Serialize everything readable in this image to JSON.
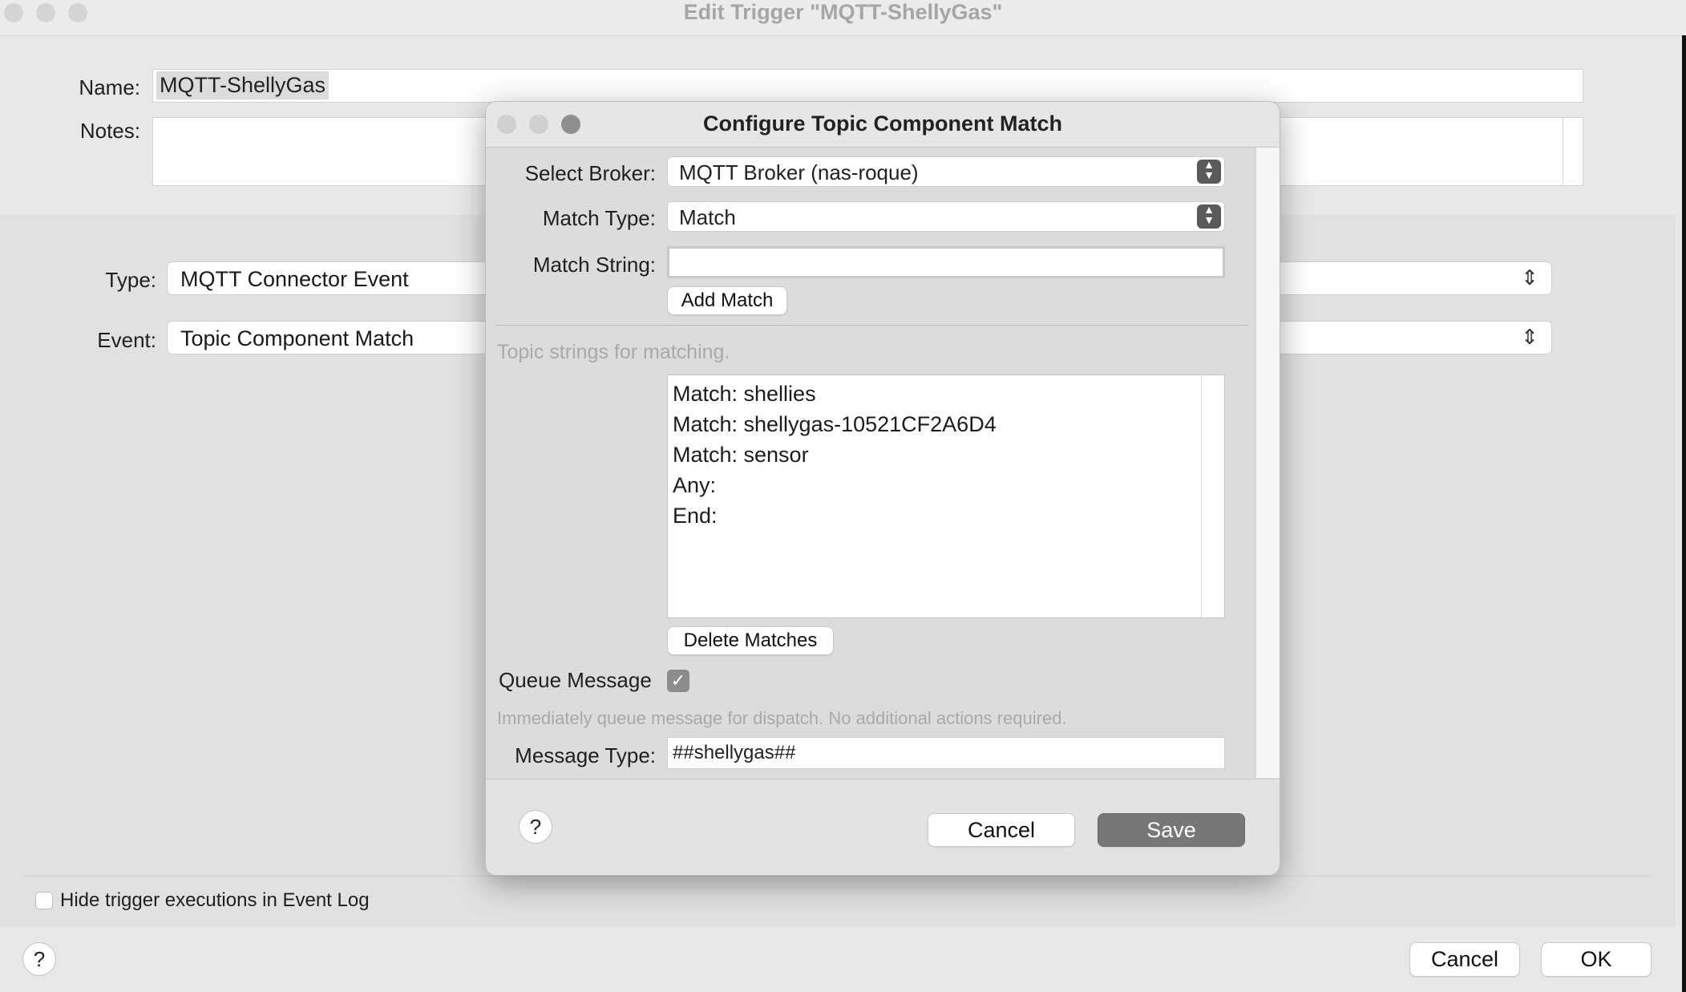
{
  "window": {
    "title": "Edit Trigger \"MQTT-ShellyGas\""
  },
  "form": {
    "name_label": "Name:",
    "name_value": "MQTT-ShellyGas",
    "notes_label": "Notes:",
    "type_label": "Type:",
    "type_value": "MQTT Connector Event",
    "event_label": "Event:",
    "event_value": "Topic Component Match",
    "hide_label": "Hide trigger executions in Event Log"
  },
  "bottom_buttons": {
    "help": "?",
    "cancel": "Cancel",
    "ok": "OK"
  },
  "modal": {
    "title": "Configure Topic Component Match",
    "broker_label": "Select Broker:",
    "broker_value": "MQTT Broker (nas-roque)",
    "match_type_label": "Match Type:",
    "match_type_value": "Match",
    "match_string_label": "Match String:",
    "match_string_value": "",
    "add_match": "Add Match",
    "topic_strings_hint": "Topic strings for matching.",
    "matches": [
      "Match: shellies",
      "Match: shellygas-10521CF2A6D4",
      "Match: sensor",
      "Any:",
      "End:"
    ],
    "delete_matches": "Delete Matches",
    "queue_label": "Queue Message",
    "queue_checked": true,
    "queue_hint": "Immediately queue message for dispatch.  No additional actions required.",
    "message_type_label": "Message Type:",
    "message_type_value": "##shellygas##",
    "help": "?",
    "cancel": "Cancel",
    "save": "Save"
  },
  "icons": {
    "check": "✓",
    "updown": "⌃⌄"
  }
}
